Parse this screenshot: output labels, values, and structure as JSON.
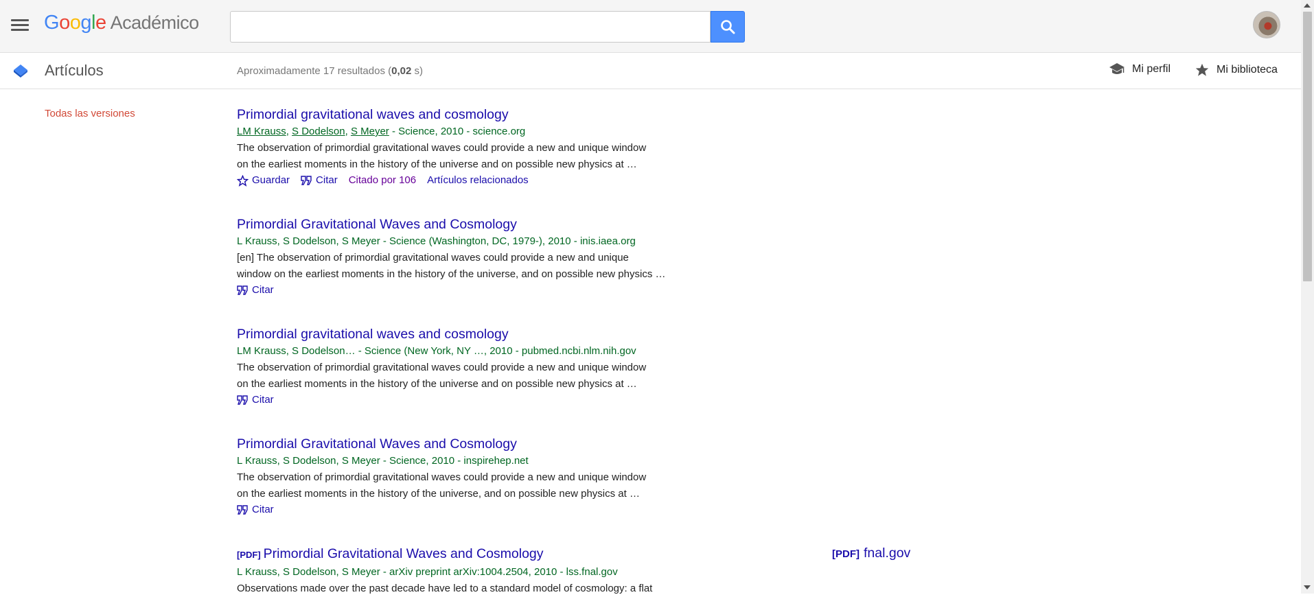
{
  "header": {
    "logo_google": [
      "G",
      "o",
      "o",
      "g",
      "l",
      "e"
    ],
    "logo_product": "Académico",
    "search_value": "",
    "search_placeholder": ""
  },
  "subheader": {
    "section_title": "Artículos",
    "stats_prefix": "Aproximadamente 17 resultados (",
    "stats_time": "0,02",
    "stats_suffix": " s)",
    "profile_label": "Mi perfil",
    "library_label": "Mi biblioteca"
  },
  "sidebar": {
    "all_versions": "Todas las versiones"
  },
  "results": [
    {
      "title": "Primordial gravitational waves and cosmology",
      "authors": [
        "LM Krauss",
        "S Dodelson",
        "S Meyer"
      ],
      "source": " - Science, 2010 - science.org",
      "snippet_1": "The observation of primordial gravitational waves could provide a new and unique window",
      "snippet_2": "on the earliest moments in the history of the universe and on possible new physics at …",
      "save": "Guardar",
      "cite": "Citar",
      "cited_by": "Citado por 106",
      "related": "Artículos relacionados"
    },
    {
      "title": "Primordial Gravitational Waves and Cosmology",
      "meta": "L Krauss, S Dodelson, S Meyer - Science (Washington, DC, 1979-), 2010 - inis.iaea.org",
      "snippet_1": "[en] The observation of primordial gravitational waves could provide a new and unique",
      "snippet_2": "window on the earliest moments in the history of the universe, and on possible new physics …",
      "cite": "Citar"
    },
    {
      "title": "Primordial gravitational waves and cosmology",
      "meta": "LM Krauss, S Dodelson… - Science (New York, NY …, 2010 - pubmed.ncbi.nlm.nih.gov",
      "snippet_1": "The observation of primordial gravitational waves could provide a new and unique window",
      "snippet_2": "on the earliest moments in the history of the universe and on possible new physics at …",
      "cite": "Citar"
    },
    {
      "title": "Primordial Gravitational Waves and Cosmology",
      "meta": "L Krauss, S Dodelson, S Meyer - Science, 2010 - inspirehep.net",
      "snippet_1": "The observation of primordial gravitational waves could provide a new and unique window",
      "snippet_2": "on the earliest moments in the history of the universe, and on possible new physics at …",
      "cite": "Citar"
    },
    {
      "pdf_tag": "[PDF]",
      "title": "Primordial Gravitational Waves and Cosmology",
      "meta": "L Krauss, S Dodelson, S Meyer - arXiv preprint arXiv:1004.2504, 2010 - lss.fnal.gov",
      "snippet_1": "Observations made over the past decade have led to a standard model of cosmology: a flat"
    }
  ],
  "side_pdf": {
    "tag": "[PDF]",
    "domain": "fnal.gov"
  },
  "colors": {
    "link": "#1a0dab",
    "meta_green": "#006621",
    "visited": "#660099",
    "sidebar_red": "#d14836",
    "search_blue": "#4d90fe"
  },
  "icons": [
    "menu-icon",
    "search-icon",
    "avatar",
    "articles-icon",
    "graduation-cap-icon",
    "star-icon",
    "star-outline-icon",
    "quote-icon"
  ]
}
